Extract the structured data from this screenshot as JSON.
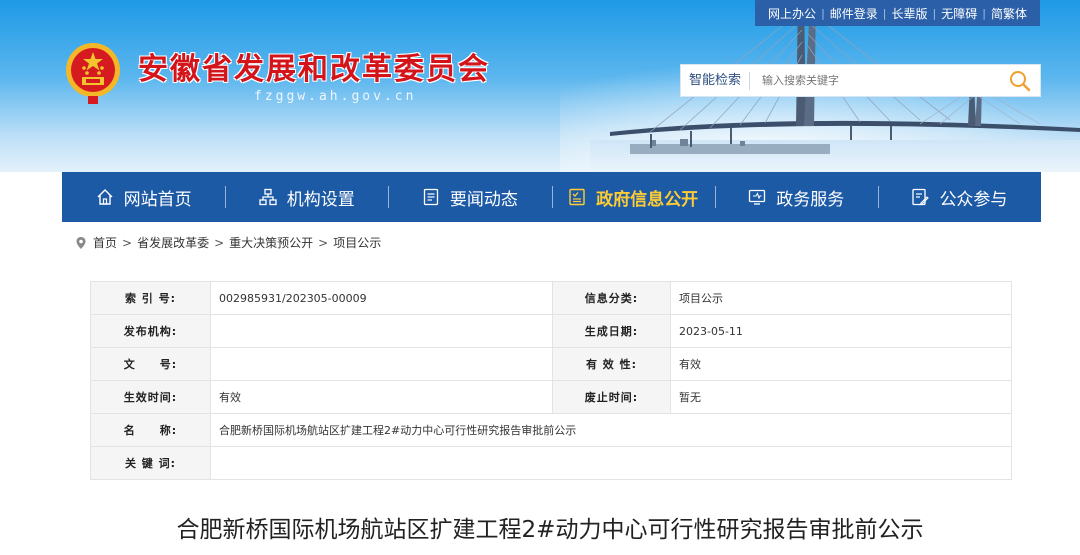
{
  "utility_links": [
    "网上办公",
    "邮件登录",
    "长辈版",
    "无障碍",
    "简繁体"
  ],
  "site": {
    "title": "安徽省发展和改革委员会",
    "domain": "fzggw.ah.gov.cn"
  },
  "search": {
    "label": "智能检索",
    "placeholder": "输入搜索关键字",
    "icon": "search-icon"
  },
  "nav": [
    {
      "label": "网站首页",
      "icon": "home-icon",
      "active": false
    },
    {
      "label": "机构设置",
      "icon": "org-chart-icon",
      "active": false
    },
    {
      "label": "要闻动态",
      "icon": "news-icon",
      "active": false
    },
    {
      "label": "政府信息公开",
      "icon": "info-disclosure-icon",
      "active": true
    },
    {
      "label": "政务服务",
      "icon": "service-icon",
      "active": false
    },
    {
      "label": "公众参与",
      "icon": "participation-icon",
      "active": false
    }
  ],
  "breadcrumb": [
    "首页",
    "省发展改革委",
    "重大决策预公开",
    "项目公示"
  ],
  "info": {
    "index_label": "索 引 号:",
    "index_value": "002985931/202305-00009",
    "category_label": "信息分类:",
    "category_value": "项目公示",
    "publisher_label": "发布机构:",
    "publisher_value": "",
    "date_label": "生成日期:",
    "date_value": "2023-05-11",
    "doc_no_label": "文　　号:",
    "doc_no_value": "",
    "validity_label": "有 效 性:",
    "validity_value": "有效",
    "effective_label": "生效时间:",
    "effective_value": "有效",
    "expiry_label": "废止时间:",
    "expiry_value": "暂无",
    "name_label": "名　　称:",
    "name_value": "合肥新桥国际机场航站区扩建工程2#动力中心可行性研究报告审批前公示",
    "keywords_label": "关 键 词:",
    "keywords_value": ""
  },
  "article_title": "合肥新桥国际机场航站区扩建工程2#动力中心可行性研究报告审批前公示",
  "colors": {
    "nav_bg": "#1d5aa6",
    "nav_active": "#ffcc33",
    "title_red": "#d3141a",
    "utility_bg": "#2b5fa8"
  }
}
